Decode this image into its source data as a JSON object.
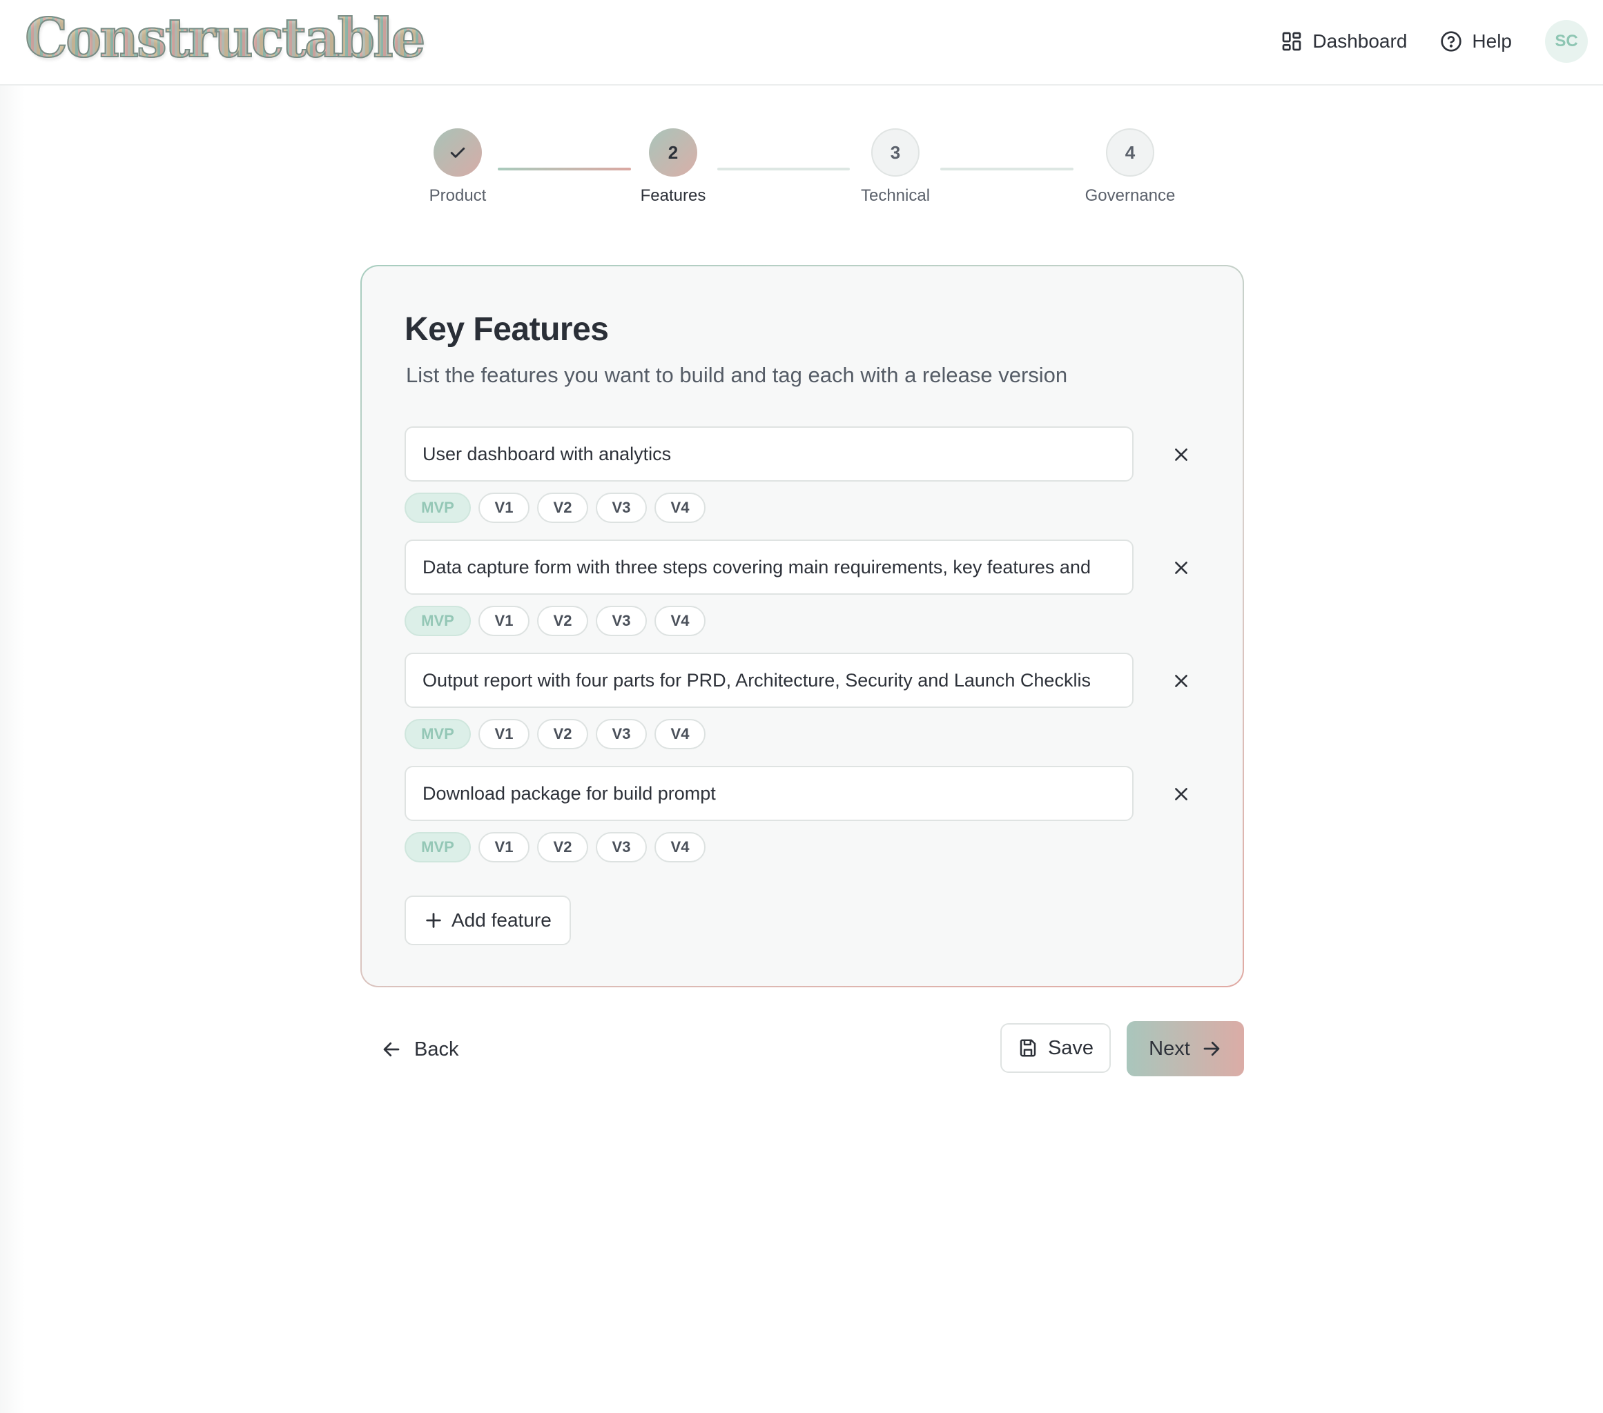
{
  "header": {
    "logo_text": "Constructable",
    "nav": {
      "dashboard_label": "Dashboard",
      "help_label": "Help"
    },
    "avatar_initials": "SC"
  },
  "stepper": {
    "steps": [
      {
        "number": "1",
        "label": "Product",
        "status": "completed"
      },
      {
        "number": "2",
        "label": "Features",
        "status": "active"
      },
      {
        "number": "3",
        "label": "Technical",
        "status": "upcoming"
      },
      {
        "number": "4",
        "label": "Governance",
        "status": "upcoming"
      }
    ]
  },
  "card": {
    "title": "Key Features",
    "subtitle": "List the features you want to build and tag each with a release version",
    "version_tags": [
      "MVP",
      "V1",
      "V2",
      "V3",
      "V4"
    ],
    "features": [
      {
        "value": "User dashboard with analytics",
        "selected_version": "MVP"
      },
      {
        "value": "Data capture form with three steps covering main requirements, key features and",
        "selected_version": "MVP"
      },
      {
        "value": "Output report with four parts for PRD, Architecture, Security and Launch Checklis",
        "selected_version": "MVP"
      },
      {
        "value": "Download package for build prompt",
        "selected_version": "MVP"
      }
    ],
    "add_feature_label": "Add feature"
  },
  "actions": {
    "back_label": "Back",
    "save_label": "Save",
    "next_label": "Next"
  },
  "colors": {
    "accent_green": "#a9c6bc",
    "accent_rose": "#dbaca6",
    "selected_tag_bg": "#dcefe8",
    "selected_tag_text": "#94c7b6"
  }
}
